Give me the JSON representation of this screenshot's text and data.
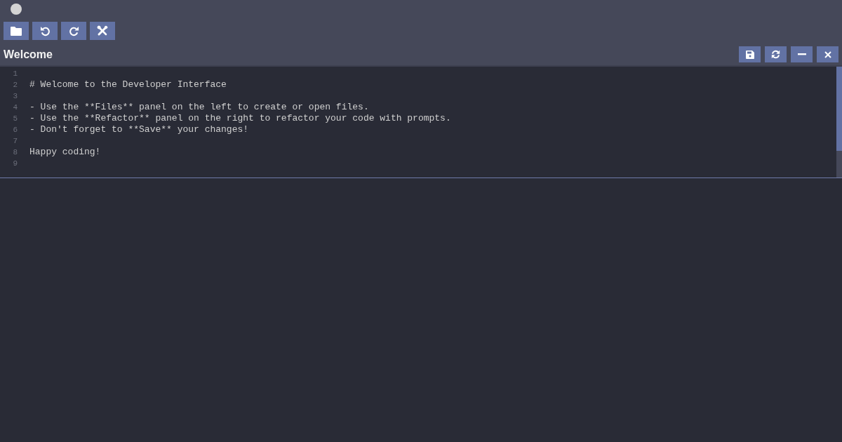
{
  "toolbar": [
    {
      "kind": "folder"
    },
    {
      "kind": "undo"
    },
    {
      "kind": "redo"
    },
    {
      "kind": "tools"
    }
  ],
  "editor": {
    "title": "Welcome",
    "actions": [
      {
        "kind": "save"
      },
      {
        "kind": "refresh"
      },
      {
        "kind": "minimize"
      },
      {
        "kind": "close"
      }
    ],
    "lines": [
      {
        "number": "1"
      },
      {
        "number": "2",
        "text": "# Welcome to the Developer Interface"
      },
      {
        "number": "3"
      },
      {
        "number": "4",
        "text": "- Use the **Files** panel on the left to create or open files."
      },
      {
        "number": "5",
        "text": "- Use the **Refactor** panel on the right to refactor your code with prompts."
      },
      {
        "number": "6",
        "text": "- Don't forget to **Save** your changes!"
      },
      {
        "number": "7"
      },
      {
        "number": "8",
        "text": "Happy coding!"
      },
      {
        "number": "9"
      }
    ]
  }
}
